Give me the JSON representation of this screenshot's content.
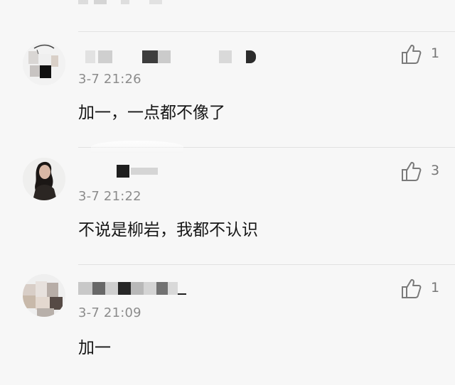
{
  "comments": [
    {
      "time": "3-7 21:26",
      "text": "加一，一点都不像了",
      "likes": "1",
      "avatar": "anonymous-pixelated-avatar",
      "name_redacted": true
    },
    {
      "time": "3-7 21:22",
      "text": "不说是柳岩，我都不认识",
      "likes": "3",
      "avatar": "woman-long-hair-avatar",
      "name_redacted": true
    },
    {
      "time": "3-7 21:09",
      "text": "加一",
      "likes": "1",
      "avatar": "pixelated-face-avatar",
      "name_redacted": true
    }
  ],
  "colors": {
    "background": "#f7f7f7",
    "text": "#161616",
    "secondary": "#8c8c8c",
    "icon": "#7a7a7a",
    "divider": "#e2e2e2"
  },
  "icons": {
    "like": "thumbs-up-icon"
  }
}
